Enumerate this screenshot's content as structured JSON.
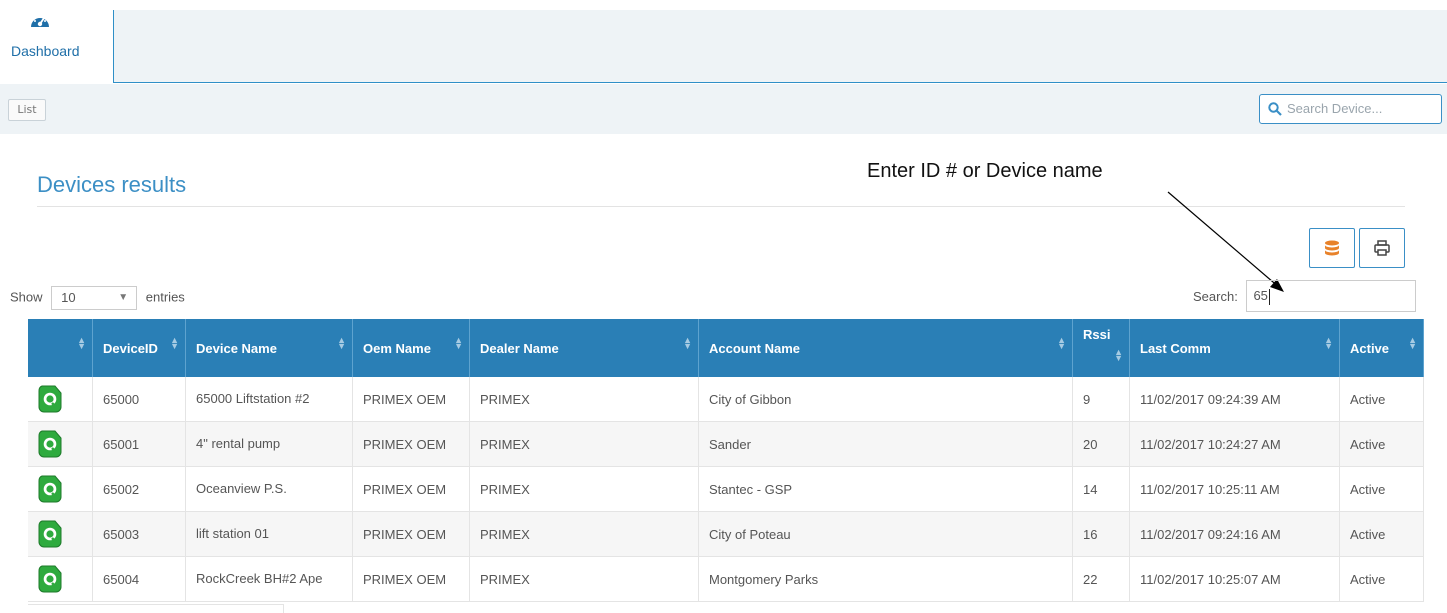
{
  "nav": {
    "dashboard_label": "Dashboard",
    "dashboard_icon": "speedometer-icon"
  },
  "toolbar": {
    "list_label": "List",
    "search_placeholder": "Search Device..."
  },
  "page": {
    "title": "Devices results"
  },
  "annotation": {
    "text": "Enter ID # or Device name"
  },
  "actions": {
    "export_icon": "database-icon",
    "print_icon": "print-icon"
  },
  "controls": {
    "show_label": "Show",
    "entries_value": "10",
    "entries_label": "entries",
    "search_label": "Search:",
    "search_value": "65"
  },
  "table": {
    "columns": [
      "",
      "DeviceID",
      "Device Name",
      "Oem Name",
      "Dealer Name",
      "Account Name",
      "Rssi",
      "Last Comm",
      "Active"
    ],
    "rows": [
      {
        "device_id": "65000",
        "device_name": "65000 Liftstation #2",
        "oem": "PRIMEX OEM",
        "dealer": "PRIMEX",
        "account": "City of Gibbon",
        "rssi": "9",
        "last_comm": "11/02/2017 09:24:39 AM",
        "active": "Active"
      },
      {
        "device_id": "65001",
        "device_name": "4\" rental pump",
        "oem": "PRIMEX OEM",
        "dealer": "PRIMEX",
        "account": "Sander",
        "rssi": "20",
        "last_comm": "11/02/2017 10:24:27 AM",
        "active": "Active"
      },
      {
        "device_id": "65002",
        "device_name": "Oceanview P.S.",
        "oem": "PRIMEX OEM",
        "dealer": "PRIMEX",
        "account": "Stantec - GSP",
        "rssi": "14",
        "last_comm": "11/02/2017 10:25:11 AM",
        "active": "Active"
      },
      {
        "device_id": "65003",
        "device_name": "lift station 01",
        "oem": "PRIMEX OEM",
        "dealer": "PRIMEX",
        "account": "City of Poteau",
        "rssi": "16",
        "last_comm": "11/02/2017 09:24:16 AM",
        "active": "Active"
      },
      {
        "device_id": "65004",
        "device_name": "RockCreek BH#2 Ape",
        "oem": "PRIMEX OEM",
        "dealer": "PRIMEX",
        "account": "Montgomery Parks",
        "rssi": "22",
        "last_comm": "11/02/2017 10:25:07 AM",
        "active": "Active"
      }
    ]
  },
  "colors": {
    "header_bg": "#2a7fb6",
    "accent": "#3c8fc5",
    "device_icon": "#2eaa3e",
    "export_icon": "#e8822a"
  }
}
